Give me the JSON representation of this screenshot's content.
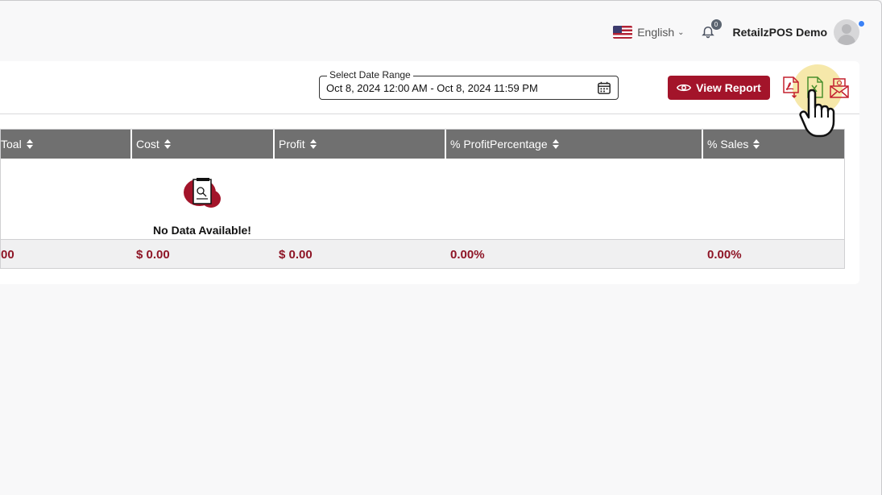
{
  "header": {
    "language": "English",
    "notification_count": "0",
    "user_name": "RetailzPOS Demo"
  },
  "filters": {
    "date_range_label": "Select Date Range",
    "date_range_value": "Oct 8, 2024 12:00 AM - Oct 8, 2024 11:59 PM",
    "view_report_label": "View Report"
  },
  "export": {
    "icons": [
      "pdf-export-icon",
      "excel-export-icon",
      "email-export-icon"
    ]
  },
  "table": {
    "columns": [
      "Toal",
      "Cost",
      "Profit",
      "% ProfitPercentage",
      "% Sales"
    ],
    "empty_message": "No Data Available!",
    "totals": [
      "00",
      "$ 0.00",
      "$ 0.00",
      "0.00%",
      "0.00%"
    ]
  },
  "colors": {
    "brand": "#a3142a",
    "header_bg": "#707070",
    "total_text": "#8e1526"
  }
}
